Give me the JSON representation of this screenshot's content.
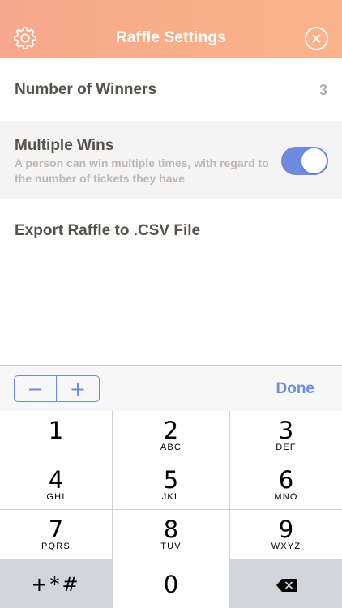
{
  "header": {
    "title": "Raffle Settings",
    "left_icon": "gear-icon",
    "right_icon": "close-circle-icon",
    "gradient_colors": [
      "#f7a88c",
      "#f9b38a"
    ]
  },
  "settings": {
    "number_of_winners": {
      "label": "Number of Winners",
      "value": "3"
    },
    "multiple_wins": {
      "label": "Multiple Wins",
      "description": "A person can win multiple times, with regard to the number of tickets they have",
      "toggle_on": true
    },
    "export": {
      "label": "Export Raffle to .CSV File"
    }
  },
  "accessory": {
    "minus": "−",
    "plus": "+",
    "done": "Done",
    "accent_color": "#6f8be0"
  },
  "keypad": {
    "keys": [
      {
        "num": "1",
        "letters": ""
      },
      {
        "num": "2",
        "letters": "ABC"
      },
      {
        "num": "3",
        "letters": "DEF"
      },
      {
        "num": "4",
        "letters": "GHI"
      },
      {
        "num": "5",
        "letters": "JKL"
      },
      {
        "num": "6",
        "letters": "MNO"
      },
      {
        "num": "7",
        "letters": "PQRS"
      },
      {
        "num": "8",
        "letters": "TUV"
      },
      {
        "num": "9",
        "letters": "WXYZ"
      }
    ],
    "symbols": "+*#",
    "zero": "0",
    "backspace_icon": "backspace-icon"
  }
}
